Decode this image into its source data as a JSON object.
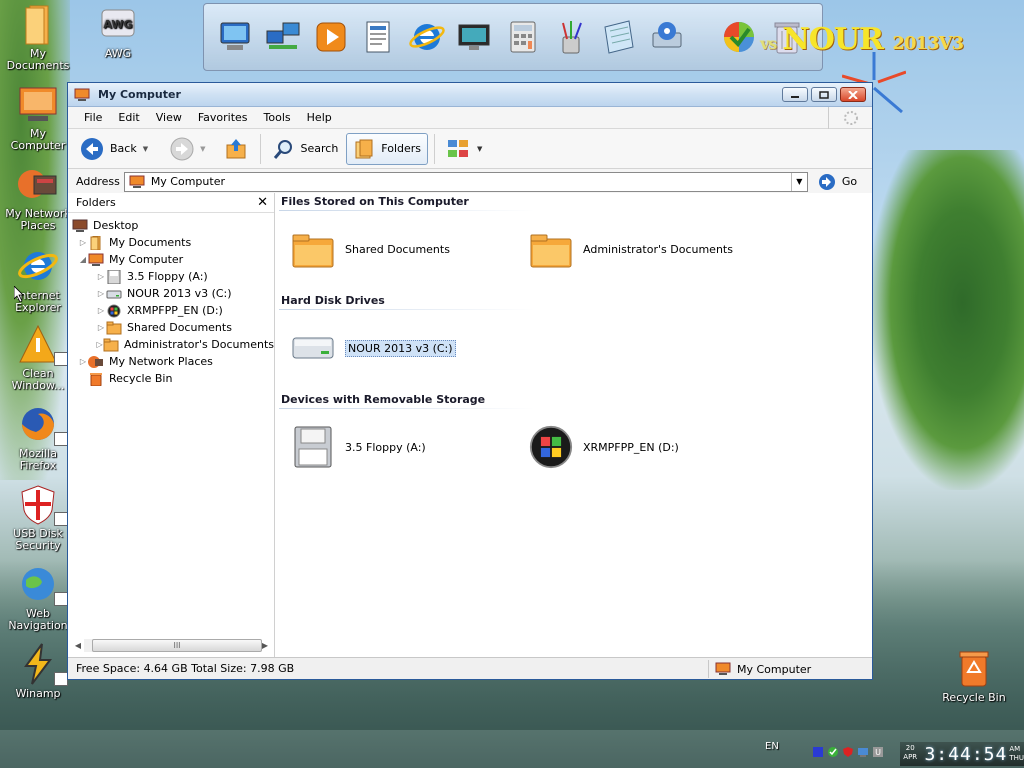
{
  "desktop": {
    "brand_text": "NOUR",
    "brand_suffix": "2013V3",
    "brand_faded": "vs",
    "icons": [
      {
        "label": "My Documents"
      },
      {
        "label": "AWG"
      },
      {
        "label": "My Computer"
      },
      {
        "label": "My Network Places"
      },
      {
        "label": "Internet Explorer"
      },
      {
        "label": "Clean Window..."
      },
      {
        "label": "Mozilla Firefox"
      },
      {
        "label": "USB Disk Security"
      },
      {
        "label": "Web Navigation"
      },
      {
        "label": "Winamp"
      },
      {
        "label": "Recycle Bin"
      }
    ]
  },
  "window": {
    "title": "My Computer",
    "menu": [
      "File",
      "Edit",
      "View",
      "Favorites",
      "Tools",
      "Help"
    ],
    "toolbar": {
      "back": "Back",
      "search": "Search",
      "folders": "Folders"
    },
    "address": {
      "label": "Address",
      "value": "My Computer",
      "go": "Go"
    },
    "folders_pane": {
      "title": "Folders",
      "close": "✕",
      "tree": [
        {
          "label": "Desktop"
        },
        {
          "label": "My Documents"
        },
        {
          "label": "My Computer"
        },
        {
          "label": "3.5 Floppy (A:)"
        },
        {
          "label": "NOUR 2013 v3 (C:)"
        },
        {
          "label": "XRMPFPP_EN (D:)"
        },
        {
          "label": "Shared Documents"
        },
        {
          "label": "Administrator's Documents"
        },
        {
          "label": "My Network Places"
        },
        {
          "label": "Recycle Bin"
        }
      ],
      "scroll_grip": "III"
    },
    "groups": {
      "files": {
        "title": "Files Stored on This Computer",
        "items": [
          "Shared Documents",
          "Administrator's Documents"
        ]
      },
      "hdd": {
        "title": "Hard Disk Drives",
        "items": [
          "NOUR 2013 v3 (C:)"
        ]
      },
      "removable": {
        "title": "Devices with Removable Storage",
        "items": [
          "3.5 Floppy (A:)",
          "XRMPFPP_EN (D:)"
        ]
      }
    },
    "status": {
      "left": "Free Space: 4.64 GB Total Size: 7.98 GB",
      "right": "My Computer"
    }
  },
  "taskbar": {
    "lang": "EN",
    "date_day": "20",
    "date_month": "APR",
    "time": "3:44:54",
    "weekday": "THU",
    "ampm": "AM"
  },
  "colors": {
    "titlebar": "#cfe1f3",
    "selection": "#cfe2f7",
    "brand": "#f7e52a",
    "close_button": "#d9472a"
  }
}
